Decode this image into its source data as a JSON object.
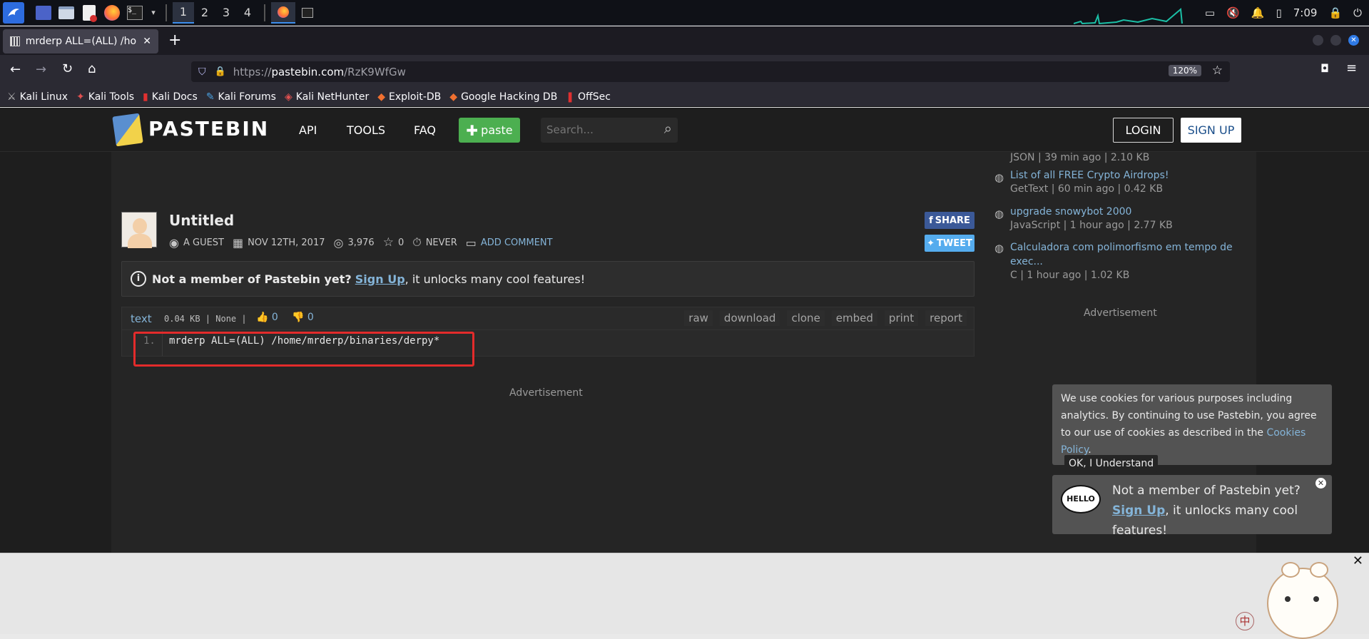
{
  "taskbar": {
    "workspaces": [
      "1",
      "2",
      "3",
      "4"
    ],
    "clock": "7:09"
  },
  "browser": {
    "tab_title": "mrderp ALL=(ALL) /home/",
    "new_tab": "+",
    "url": "https://pastebin.com/RzK9WfGw",
    "url_prefix": "https://",
    "url_host": "pastebin.com",
    "url_path": "/RzK9WfGw",
    "zoom": "120%",
    "bookmarks": [
      "Kali Linux",
      "Kali Tools",
      "Kali Docs",
      "Kali Forums",
      "Kali NetHunter",
      "Exploit-DB",
      "Google Hacking DB",
      "OffSec"
    ]
  },
  "header": {
    "logo_text": "PASTEBIN",
    "nav": [
      "API",
      "TOOLS",
      "FAQ"
    ],
    "paste_button": "paste",
    "search_placeholder": "Search...",
    "login": "LOGIN",
    "signup": "SIGN UP"
  },
  "paste": {
    "title": "Untitled",
    "author": "A GUEST",
    "date": "NOV 12TH, 2017",
    "views": "3,976",
    "stars": "0",
    "expiry": "NEVER",
    "add_comment": "ADD COMMENT",
    "share": "SHARE",
    "tweet": "TWEET",
    "format": "text",
    "size": "0.04 KB | None |",
    "likes": "0",
    "dislikes": "0",
    "actions": [
      "raw",
      "download",
      "clone",
      "embed",
      "print",
      "report"
    ],
    "line_number": "1.",
    "code": "mrderp ALL=(ALL) /home/mrderp/binaries/derpy*"
  },
  "notice": {
    "bold": "Not a member of Pastebin yet?",
    "link": "Sign Up",
    "rest": ", it unlocks many cool features!"
  },
  "ad_label": "Advertisement",
  "sidebar": {
    "items": [
      {
        "title": "",
        "meta": "JSON | 39 min ago | 2.10 KB"
      },
      {
        "title": "List of all FREE Crypto Airdrops!",
        "meta": "GetText | 60 min ago | 0.42 KB"
      },
      {
        "title": "upgrade snowybot 2000",
        "meta": "JavaScript | 1 hour ago | 2.77 KB"
      },
      {
        "title": "Calculadora com polimorfismo em tempo de exec...",
        "meta": "C | 1 hour ago | 1.02 KB"
      }
    ],
    "ad_label": "Advertisement"
  },
  "cookie": {
    "text": "We use cookies for various purposes including analytics. By continuing to use Pastebin, you agree to our use of cookies as described in the",
    "link": "Cookies Policy",
    "period": ".",
    "button": "OK, I Understand"
  },
  "popup": {
    "badge": "HELLO",
    "line1": "Not a member of Pastebin yet?",
    "link": "Sign Up",
    "rest": ", it unlocks many cool features!"
  },
  "mascot": {
    "char": "中"
  },
  "colors": {
    "accent_green": "#4caf50",
    "link_blue": "#84b4d8",
    "highlight_red": "#e32b2b",
    "facebook": "#3b5998",
    "twitter": "#55acee"
  }
}
